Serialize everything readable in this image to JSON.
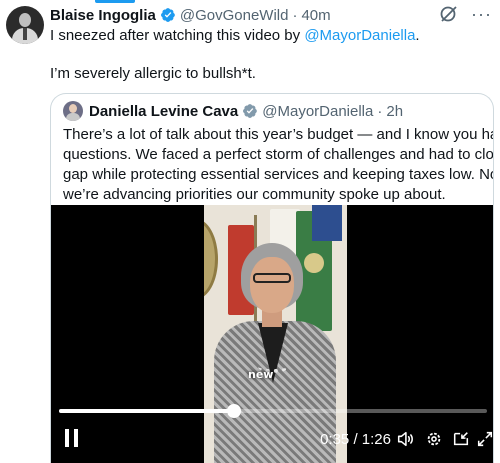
{
  "post": {
    "author_name": "Blaise Ingoglia",
    "handle": "@GovGoneWild",
    "separator": "·",
    "time": "40m",
    "text_line1_prefix": "I sneezed after watching this video by ",
    "text_line1_mention": "@MayorDaniella",
    "text_line1_suffix": ".",
    "text_line2": "I’m severely allergic to bullsh*t.",
    "avatar_icon": "profile-photo",
    "verified_icon": "verified-badge-icon",
    "grok_icon": "grok-icon",
    "more_icon": "more-options-icon",
    "more_glyph": "···"
  },
  "quote": {
    "author_name": "Daniella Levine Cava",
    "handle": "@MayorDaniella",
    "separator": "·",
    "time": "2h",
    "text_lines": [
      "There’s a lot of talk about this year’s budget — and I know you have",
      "questions. We faced a perfect storm of challenges and had to close a",
      "gap while protecting essential services and keeping taxes low. Now",
      "we’re advancing priorities our community spoke up about."
    ]
  },
  "video": {
    "caption": "new",
    "current_time": "0:35",
    "duration": "1:26",
    "time_separator": " / ",
    "progress": 0.41,
    "controls": [
      "pause-icon",
      "volume-icon",
      "settings-icon",
      "pip-icon",
      "fullscreen-icon"
    ]
  },
  "colors": {
    "accent": "#1d9bf0",
    "text": "#0f1419",
    "secondary": "#536471",
    "border": "#cfd9de"
  }
}
